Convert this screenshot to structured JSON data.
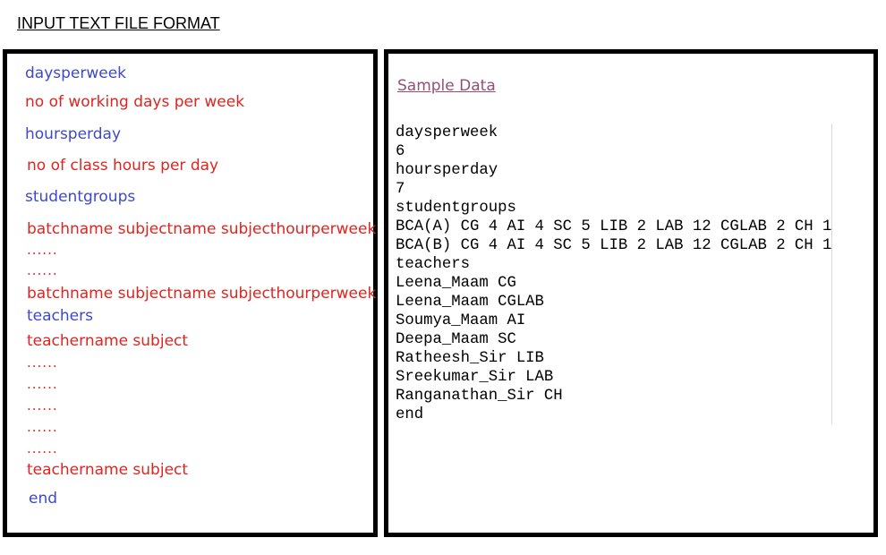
{
  "title": "INPUT TEXT FILE FORMAT",
  "format_box": {
    "lines": [
      {
        "text": "daysperweek",
        "color": "blue"
      },
      {
        "text": "no of working days per week",
        "color": "red"
      },
      {
        "text": "hoursperday",
        "color": "blue"
      },
      {
        "text": "no of class hours per day",
        "color": "red"
      },
      {
        "text": "studentgroups",
        "color": "blue"
      },
      {
        "text": "batchname subjectname subjecthourperweek",
        "color": "red"
      },
      {
        "text": "......",
        "color": "red"
      },
      {
        "text": "......",
        "color": "red"
      },
      {
        "text": "batchname subjectname subjecthourperweek",
        "color": "red"
      },
      {
        "text": "teachers",
        "color": "blue"
      },
      {
        "text": "teachername subject",
        "color": "red"
      },
      {
        "text": "......",
        "color": "red"
      },
      {
        "text": "......",
        "color": "red"
      },
      {
        "text": "......",
        "color": "red"
      },
      {
        "text": "......",
        "color": "red"
      },
      {
        "text": "......",
        "color": "red"
      },
      {
        "text": "teachername subject",
        "color": "red"
      },
      {
        "text": "end",
        "color": "blue"
      }
    ]
  },
  "sample_box": {
    "link_label": "Sample Data",
    "lines": [
      "daysperweek",
      "6",
      "hoursperday",
      "7",
      "studentgroups",
      "BCA(A) CG 4 AI 4 SC 5 LIB 2 LAB 12 CGLAB 2 CH 1",
      "BCA(B) CG 4 AI 4 SC 5 LIB 2 LAB 12 CGLAB 2 CH 1",
      "teachers",
      "Leena_Maam CG",
      "Leena_Maam CGLAB",
      "Soumya_Maam AI",
      "Deepa_Maam SC",
      "Ratheesh_Sir LIB",
      "Sreekumar_Sir LAB",
      "Ranganathan_Sir CH",
      "end"
    ]
  },
  "colors": {
    "blue": "#3f48cc",
    "red": "#e0241f",
    "link": "#954f72"
  }
}
